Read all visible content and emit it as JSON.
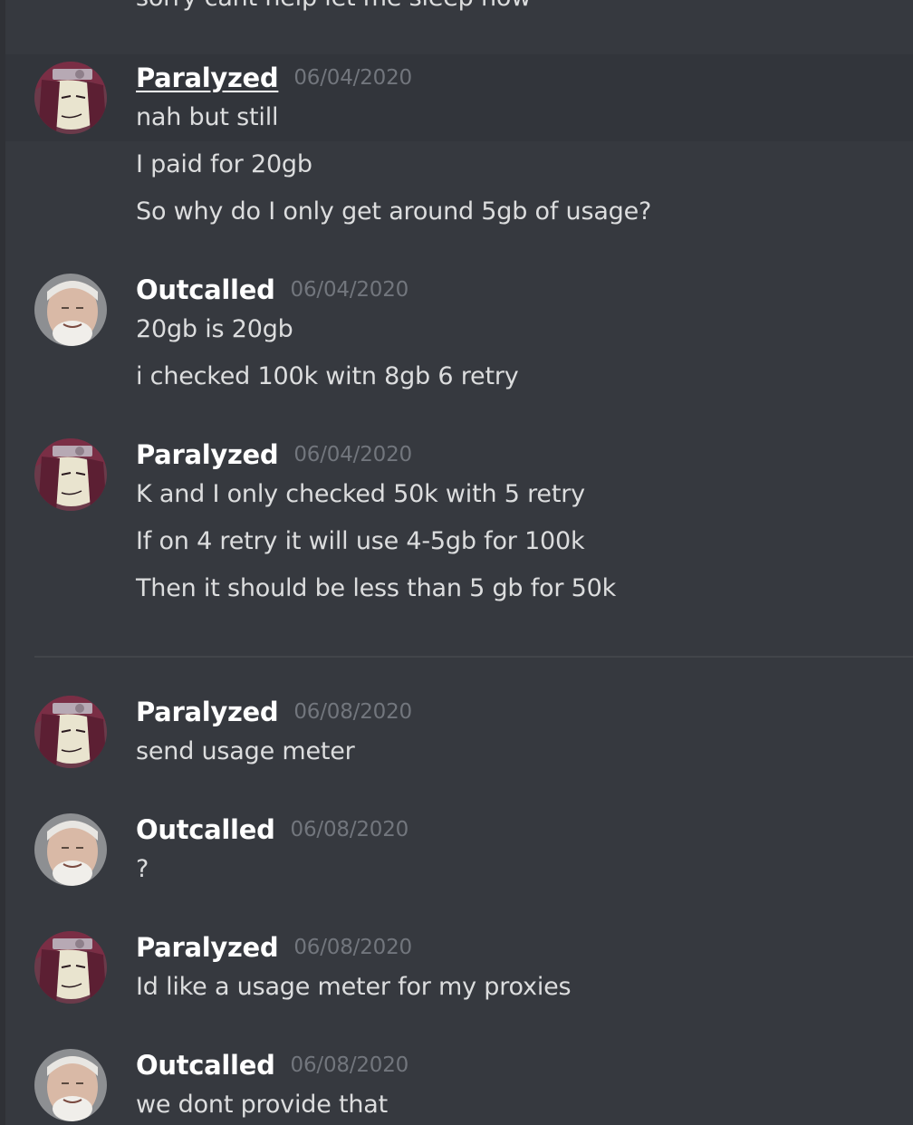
{
  "partial_message": "sorry cant help let me sleep now",
  "messages": [
    {
      "author": "Paralyzed",
      "timestamp": "06/04/2020",
      "avatar": "anime-avatar",
      "lines": [
        "nah but still",
        "I paid for 20gb",
        "So why do I only get around 5gb of usage?"
      ]
    },
    {
      "author": "Outcalled",
      "timestamp": "06/04/2020",
      "avatar": "old-man-avatar",
      "lines": [
        "20gb is 20gb",
        "i checked 100k witn 8gb 6 retry"
      ]
    },
    {
      "author": "Paralyzed",
      "timestamp": "06/04/2020",
      "avatar": "anime-avatar",
      "lines": [
        "K and I only checked 50k with 5 retry",
        "If on 4 retry it will use 4-5gb for 100k",
        "Then it should be less than 5 gb for 50k"
      ]
    },
    {
      "author": "Paralyzed",
      "timestamp": "06/08/2020",
      "avatar": "anime-avatar",
      "lines": [
        "send usage meter"
      ]
    },
    {
      "author": "Outcalled",
      "timestamp": "06/08/2020",
      "avatar": "old-man-avatar",
      "lines": [
        "?"
      ]
    },
    {
      "author": "Paralyzed",
      "timestamp": "06/08/2020",
      "avatar": "anime-avatar",
      "lines": [
        "Id like a usage meter for my proxies"
      ]
    },
    {
      "author": "Outcalled",
      "timestamp": "06/08/2020",
      "avatar": "old-man-avatar",
      "lines": [
        "we dont provide that"
      ]
    }
  ],
  "colors": {
    "background": "#36393f",
    "username": "#ffffff",
    "timestamp": "#72767d",
    "message_text": "#dcddde",
    "divider": "#42454a"
  }
}
